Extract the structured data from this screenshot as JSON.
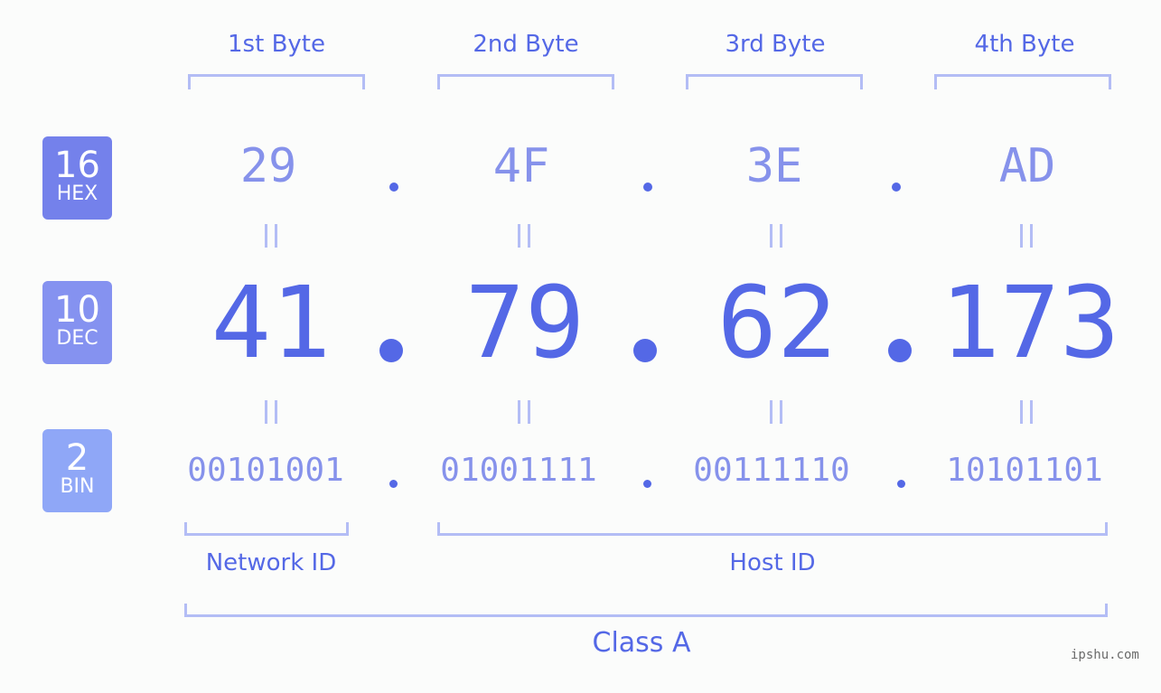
{
  "byte_headers": [
    "1st Byte",
    "2nd Byte",
    "3rd Byte",
    "4th Byte"
  ],
  "badges": {
    "hex": {
      "num": "16",
      "label": "HEX",
      "color": "#7481eb"
    },
    "dec": {
      "num": "10",
      "label": "DEC",
      "color": "#8592f0"
    },
    "bin": {
      "num": "2",
      "label": "BIN",
      "color": "#8fa7f7"
    }
  },
  "hex_values": [
    "29",
    "4F",
    "3E",
    "AD"
  ],
  "dec_values": [
    "41",
    "79",
    "62",
    "173"
  ],
  "bin_values": [
    "00101001",
    "01001111",
    "00111110",
    "10101101"
  ],
  "separator": ".",
  "equals_sign": "=",
  "groups": {
    "network": "Network ID",
    "host": "Host ID",
    "class": "Class A"
  },
  "watermark": "ipshu.com"
}
